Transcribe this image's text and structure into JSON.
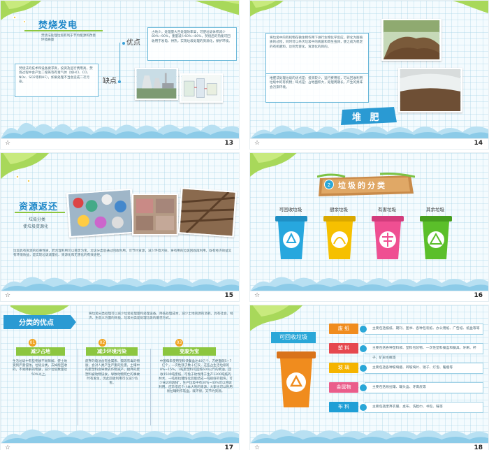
{
  "slides": {
    "s13": {
      "title": "焚烧发电",
      "tag_left_text": "焚烧法处理垃圾有利于节约能源和改善环境质量",
      "advantage_label": "优点",
      "advantage_text": "占地少，处理量大且处理效率高，可使垃圾体积减少80%~90%，重量减少60%~80%，焚烧后的热能可回收用于发电、供热，实现垃圾处理的资源化，保护环境。",
      "disadvantage_label": "缺点",
      "disadvantage_text": "焚烧法的技术和设备要求高，投资及运行费用高，焚烧过程中会产生二噁英等有毒气体（如HCl、CO、NOx、SO2等和HF），如果处理不当会造成二次污染。",
      "number": "13"
    },
    "s14": {
      "text1": "将垃圾中的有机物在微生物作用下进行生物化学反应，转化为腐殖质的过程，同时可以杀灭垃圾中的病菌和寄生虫卵，使之成为稳定的有机肥料，达到无害化、资源化的目的。",
      "text2": "堆肥法处理垃圾的优点是：投资较少，运行费用低，可以回收利用垃圾中的有机物；缺点是：占地面积大，处理周期长，产生的臭味会污染环境。",
      "title": "堆 肥",
      "number": "14"
    },
    "s15": {
      "title": "资源返还",
      "line1": "垃圾分类",
      "line2": "使垃圾资源化",
      "body": "垃圾具有资源的双重性质，若合理利用可以变废为宝，垃圾分类后通过回收利用，可节约资源，减少环境污染，将有用的垃圾回收再利用，既有经济效益又有环境效益，是实现垃圾减量化、资源化和无害化的有效途径。",
      "number": "15"
    },
    "s16": {
      "badge": "2",
      "title": "垃圾的分类",
      "bins": [
        {
          "label": "可回收垃圾",
          "color": "#27a7de"
        },
        {
          "label": "厨余垃圾",
          "color": "#f6c000"
        },
        {
          "label": "有害垃圾",
          "color": "#ef4f92"
        },
        {
          "label": "其余垃圾",
          "color": "#5bbf2a"
        }
      ],
      "number": "16"
    },
    "s17": {
      "title": "分类的优点",
      "intro": "将垃圾分类处理可以减少垃圾处理量和处理设备，降低处理成本，减少土地资源的消耗，具有社会、经济、生态三方面的效益，垃圾分类是处理垃圾的最佳方式。",
      "cards": [
        {
          "num": "01",
          "head": "减少占地",
          "text": "生活垃圾中有些物质不易降解，使土地受到严重侵蚀，垃圾分类，去掉能回收的，不易降解的物质，减少垃圾数量达50%以上。"
        },
        {
          "num": "02",
          "head": "减少环境污染",
          "text": "废弃的电池含有金属汞、镉等有毒的物质，会对人类产生严重的危害，土壤中的废塑料会导致农作物减产，抛弃的废塑料被动物误食，导致动物死亡的事故时有发生，因此回收利用可以减少危害。"
        },
        {
          "num": "03",
          "head": "变废为宝",
          "text": "中国每年使用塑料快餐盒达40亿个，方便面碗5~7亿个，一次性筷子数十亿双，这些占生活垃圾的8%~15%，1吨废塑料可回炼600公斤的柴油，回收1500吨废纸，可免于砍伐用于生产1200吨纸的林木，一吨易拉罐熔化后能结成一吨很好的铝块，可少采20吨铝矿，生产垃圾中有30%~40%可以回收利用，应珍惜这个小本大利的资源，大家也可以利用易拉罐制作笔盒，既环保，又节约资源。"
        }
      ],
      "number": "17"
    },
    "s18": {
      "title": "可回收垃圾",
      "items": [
        {
          "name": "废 纸",
          "color": "#f08c1e",
          "desc": "主要包括报纸、期刊、图书、各种包装纸、办公用纸、广告纸、纸盒等等"
        },
        {
          "name": "塑 料",
          "color": "#e6484f",
          "desc": "主要包括各种塑料袋、塑料包装物、一次性塑料餐盒和餐具、牙刷、杯子、矿泉水瓶等"
        },
        {
          "name": "玻 璃",
          "color": "#f5b400",
          "desc": "主要包括各种玻璃瓶、碎玻璃片、镜子、灯泡、暖瓶等"
        },
        {
          "name": "金属物",
          "color": "#ea5d8b",
          "desc": "主要包括易拉罐、罐头盒、牙膏皮等"
        },
        {
          "name": "布 料",
          "color": "#1f9fd6",
          "desc": "主要包括废弃衣服、桌布、洗脸巾、书包、鞋等"
        }
      ],
      "number": "18"
    }
  },
  "footer_icon": "star-icon"
}
